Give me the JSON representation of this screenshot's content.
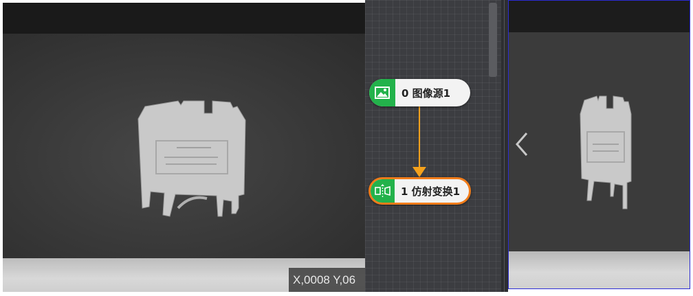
{
  "viewer": {
    "coordinate_readout": "X,0008  Y,06"
  },
  "flow": {
    "nodes": [
      {
        "label": "0 图像源1",
        "icon": "image-icon",
        "color": "#23b24b"
      },
      {
        "label": "1 仿射变换1",
        "icon": "affine-transform-icon",
        "color": "#23b24b",
        "selected": true,
        "selected_border": "#f07c1a"
      }
    ],
    "link_color": "#f4a11c"
  },
  "preview": {
    "prev_icon": "chevron-left-icon",
    "border_color": "#2b2bd6"
  }
}
